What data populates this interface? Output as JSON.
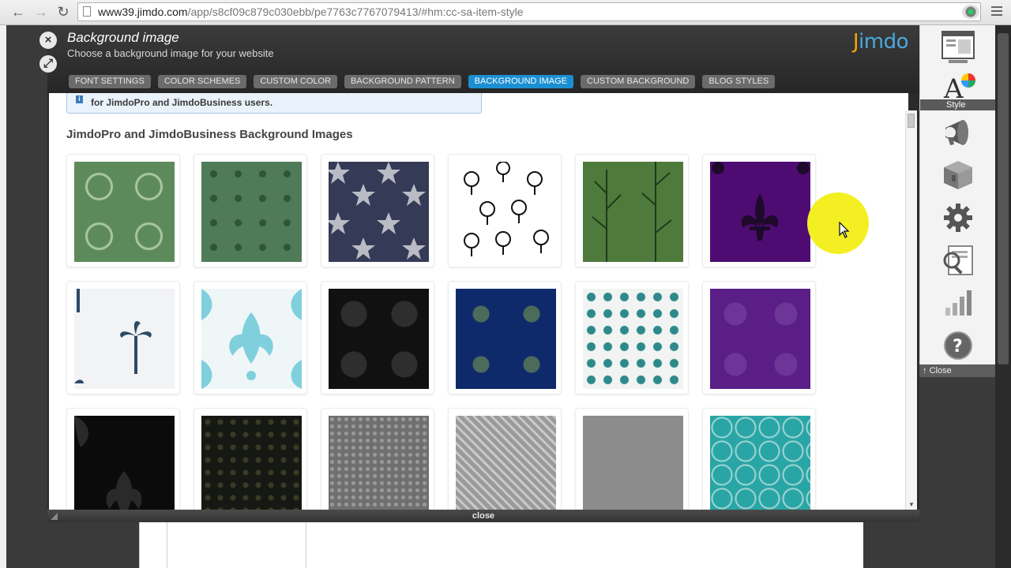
{
  "browser": {
    "url_host": "www39.jimdo.com",
    "url_path": "/app/s8cf09c879c030ebb/pe7763c7767079413/#hm:cc-sa-item-style"
  },
  "panel": {
    "title": "Background image",
    "subtitle": "Choose a background image for your website",
    "logo_prefix": "J",
    "logo_rest": "imdo",
    "tabs": [
      {
        "label": "FONT SETTINGS",
        "active": false
      },
      {
        "label": "COLOR SCHEMES",
        "active": false
      },
      {
        "label": "CUSTOM COLOR",
        "active": false
      },
      {
        "label": "BACKGROUND PATTERN",
        "active": false
      },
      {
        "label": "BACKGROUND IMAGE",
        "active": true
      },
      {
        "label": "CUSTOM BACKGROUND",
        "active": false
      },
      {
        "label": "BLOG STYLES",
        "active": false
      }
    ],
    "notice": "for JimdoPro and JimdoBusiness users.",
    "section_title": "JimdoPro and JimdoBusiness Background Images",
    "footer": "close"
  },
  "thumbnails": [
    {
      "pattern": "green-medallion"
    },
    {
      "pattern": "green-flower"
    },
    {
      "pattern": "navy-stars"
    },
    {
      "pattern": "trees-outline"
    },
    {
      "pattern": "green-trees"
    },
    {
      "pattern": "purple-fleur"
    },
    {
      "pattern": "white-palm"
    },
    {
      "pattern": "cyan-damask"
    },
    {
      "pattern": "black-swirl"
    },
    {
      "pattern": "navy-ornament"
    },
    {
      "pattern": "teal-damask"
    },
    {
      "pattern": "purple-flower"
    },
    {
      "pattern": "black-damask"
    },
    {
      "pattern": "dark-olive"
    },
    {
      "pattern": "gray-lace"
    },
    {
      "pattern": "gray-swirl"
    },
    {
      "pattern": "gray-plain"
    },
    {
      "pattern": "teal-rings"
    }
  ],
  "toolbar": {
    "style_label": "Style",
    "close_label": "Close",
    "icons": [
      "layout-icon",
      "style-icon",
      "megaphone-icon",
      "box-icon",
      "settings-gear-icon",
      "seo-search-icon",
      "statistics-icon",
      "help-icon"
    ]
  },
  "colors": {
    "accent_tab": "#1c8fd3",
    "logo_orange": "#f3a400",
    "logo_blue": "#49a9df",
    "cursor_halo": "#f4ef22"
  }
}
